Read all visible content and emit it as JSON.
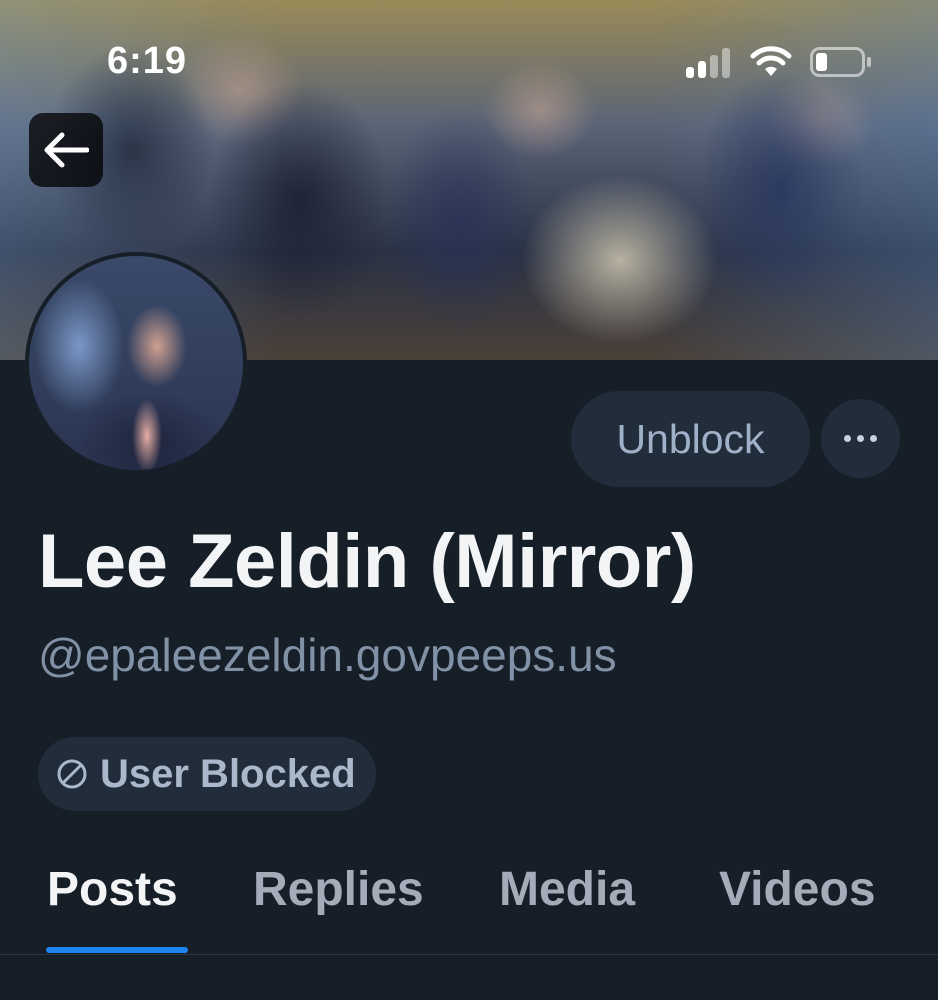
{
  "status_bar": {
    "time": "6:19"
  },
  "header": {
    "back_icon": "arrow-left-icon"
  },
  "profile": {
    "display_name": "Lee Zeldin (Mirror)",
    "handle": "@epaleezeldin.govpeeps.us",
    "unblock_label": "Unblock",
    "more_icon": "ellipsis-icon",
    "blocked_badge": {
      "icon": "blocked-icon",
      "label": "User Blocked"
    }
  },
  "tabs": [
    {
      "label": "Posts",
      "active": true
    },
    {
      "label": "Replies",
      "active": false
    },
    {
      "label": "Media",
      "active": false
    },
    {
      "label": "Videos",
      "active": false
    }
  ],
  "colors": {
    "background": "#161e27",
    "button_bg": "#222d3b",
    "accent": "#1d84f2",
    "muted_text": "#8191a6"
  }
}
